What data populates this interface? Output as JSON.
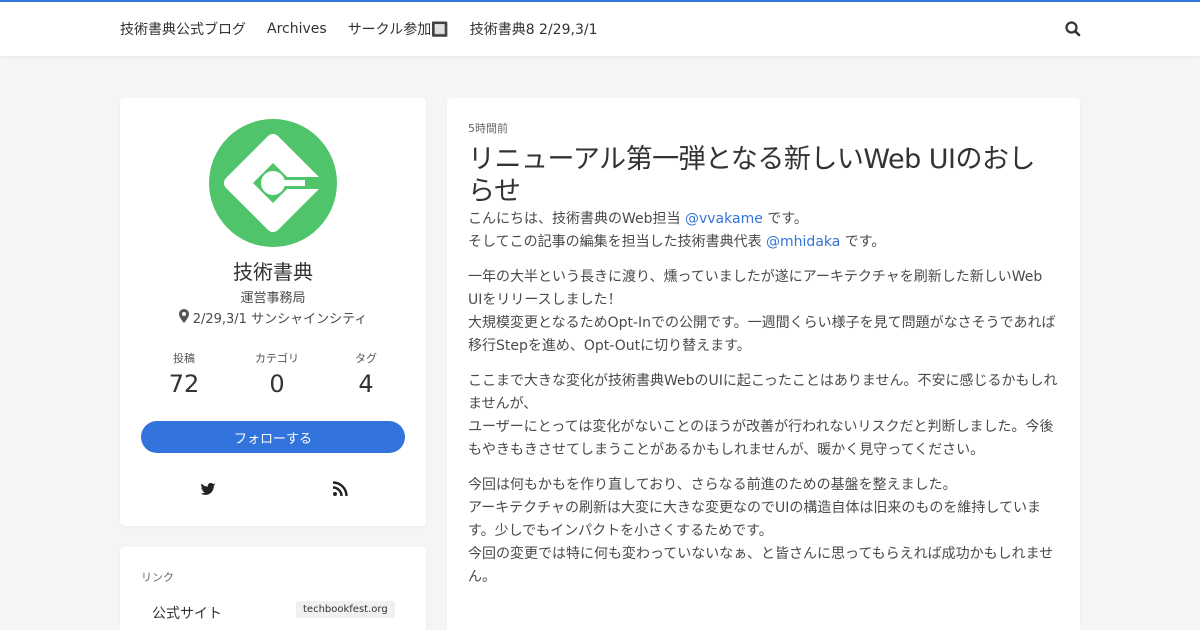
{
  "nav": {
    "items": [
      "技術書典公式ブログ",
      "Archives",
      "サークル参加🔲",
      "技術書典8 2/29,3/1"
    ]
  },
  "profile": {
    "name": "技術書典",
    "org": "運営事務局",
    "location": "2/29,3/1 サンシャインシティ",
    "stats": [
      {
        "label": "投稿",
        "value": "72"
      },
      {
        "label": "カテゴリ",
        "value": "0"
      },
      {
        "label": "タグ",
        "value": "4"
      }
    ],
    "follow_label": "フォローする"
  },
  "links": {
    "title": "リンク",
    "items": [
      {
        "name": "公式サイト",
        "tag": "techbookfest.org"
      }
    ]
  },
  "article": {
    "time": "5時間前",
    "title": "リニューアル第一弾となる新しいWeb UIのおしらせ",
    "p1": {
      "l1a": "こんにちは、技術書典のWeb担当 ",
      "l1link": "@vvakame",
      "l1b": " です。",
      "l2a": "そしてこの記事の編集を担当した技術書典代表 ",
      "l2link": "@mhidaka",
      "l2b": " です。"
    },
    "p2": [
      "一年の大半という長きに渡り、燻っていましたが遂にアーキテクチャを刷新した新しいWeb UIをリリースしました！",
      "大規模変更となるためOpt-Inでの公開です。一週間くらい様子を見て問題がなさそうであれば移行Stepを進め、Opt-Outに切り替えます。"
    ],
    "p3": [
      "ここまで大きな変化が技術書典WebのUIに起こったことはありません。不安に感じるかもしれませんが、",
      "ユーザーにとっては変化がないことのほうが改善が行われないリスクだと判断しました。今後もやきもきさせてしまうことがあるかもしれませんが、暖かく見守ってください。"
    ],
    "p4": [
      "今回は何もかもを作り直しており、さらなる前進のための基盤を整えました。",
      "アーキテクチャの刷新は大変に大きな変更なのでUIの構造自体は旧来のものを維持しています。少しでもインパクトを小さくするためです。",
      "今回の変更では特に何も変わっていないなぁ、と皆さんに思ってもらえれば成功かもしれません。"
    ]
  },
  "colors": {
    "accent": "#3273dc",
    "logo": "#4fc46a"
  }
}
